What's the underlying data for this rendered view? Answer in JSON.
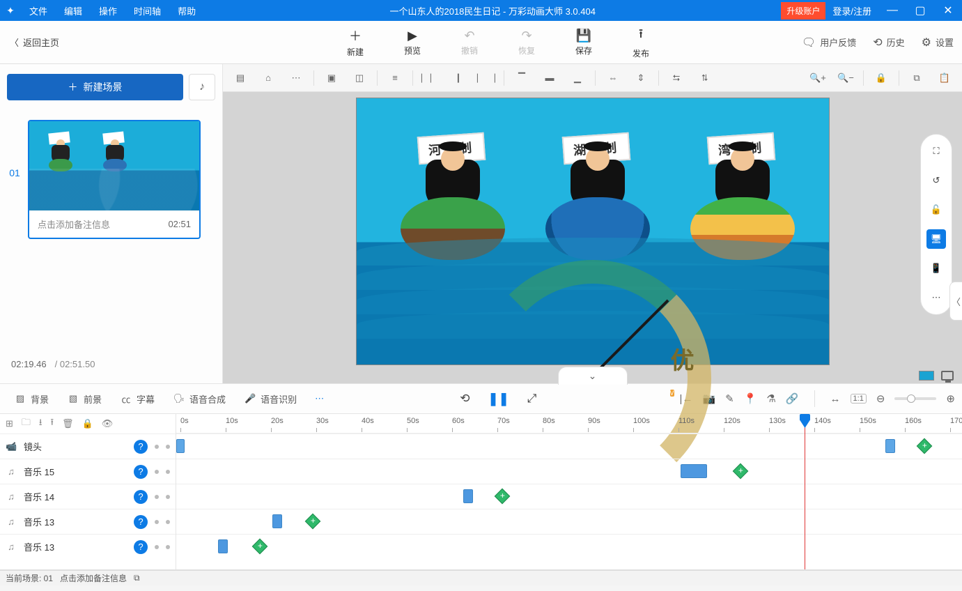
{
  "titlebar": {
    "menus": [
      "文件",
      "编辑",
      "操作",
      "时间轴",
      "帮助"
    ],
    "doc_title": "一个山东人的2018民生日记 - 万彩动画大师 3.0.404",
    "upgrade": "升级账户",
    "login": "登录/注册"
  },
  "maintool": {
    "back": "返回主页",
    "new": "新建",
    "preview": "预览",
    "undo": "撤销",
    "redo": "恢复",
    "save": "保存",
    "publish": "发布",
    "feedback": "用户反馈",
    "history": "历史",
    "settings": "设置"
  },
  "sidebar": {
    "new_scene": "新建场景",
    "scene_index": "01",
    "scene_note": "点击添加备注信息",
    "scene_duration": "02:51",
    "time_current": "02:19.46",
    "time_total": "/ 02:51.50"
  },
  "stage": {
    "sign1": "河长制",
    "sign2": "湖长制",
    "sign3": "湾长制",
    "gauge_label": "优"
  },
  "tltabs": {
    "bg": "背景",
    "fg": "前景",
    "sub": "字幕",
    "tts": "语音合成",
    "asr": "语音识别",
    "ratio": "1:1"
  },
  "ruler": [
    "0s",
    "10s",
    "20s",
    "30s",
    "40s",
    "50s",
    "60s",
    "70s",
    "80s",
    "90s",
    "100s",
    "110s",
    "120s",
    "130s",
    "140s",
    "150s",
    "160s",
    "170"
  ],
  "tracks": [
    {
      "name": "镜头"
    },
    {
      "name": "音乐 15"
    },
    {
      "name": "音乐 14"
    },
    {
      "name": "音乐 13"
    },
    {
      "name": "音乐 13"
    }
  ],
  "status": {
    "scene": "当前场景: 01",
    "note": "点击添加备注信息"
  }
}
